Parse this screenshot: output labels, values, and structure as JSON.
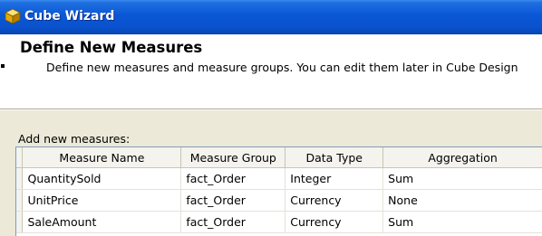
{
  "window": {
    "title": "Cube Wizard",
    "icon": "cube-icon"
  },
  "header": {
    "title": "Define New Measures",
    "subtitle": "Define new measures and measure groups. You can edit them later in Cube Design"
  },
  "measures": {
    "label": "Add new measures:",
    "columns": [
      "Measure Name",
      "Measure Group",
      "Data Type",
      "Aggregation"
    ],
    "rows": [
      [
        "QuantitySold",
        "fact_Order",
        "Integer",
        "Sum"
      ],
      [
        "UnitPrice",
        "fact_Order",
        "Currency",
        "None"
      ],
      [
        "SaleAmount",
        "fact_Order",
        "Currency",
        "Sum"
      ]
    ]
  },
  "colors": {
    "titlebar": "#0A57D6",
    "grid_border": "#7F9DB9",
    "dialog_bg": "#ECE9D8"
  }
}
